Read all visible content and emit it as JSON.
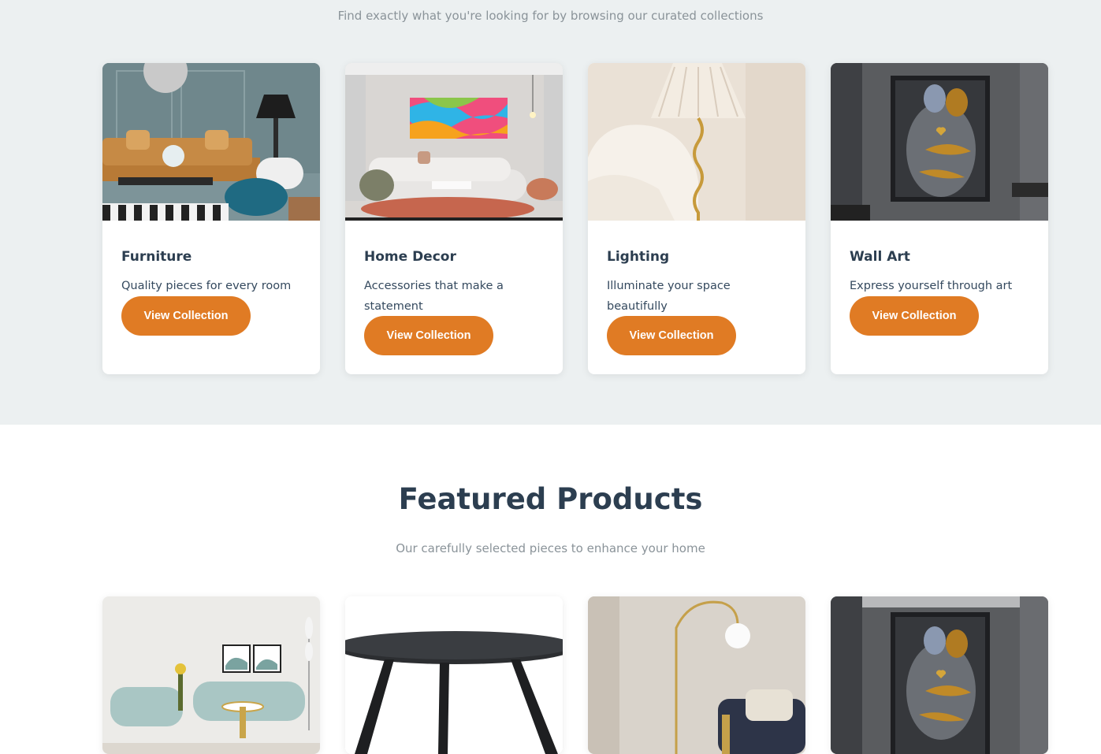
{
  "collections": {
    "subtitle": "Find exactly what you're looking for by browsing our curated collections",
    "items": [
      {
        "title": "Furniture",
        "description": "Quality pieces for every room",
        "button": "View Collection"
      },
      {
        "title": "Home Decor",
        "description": "Accessories that make a statement",
        "button": "View Collection"
      },
      {
        "title": "Lighting",
        "description": "Illuminate your space beautifully",
        "button": "View Collection"
      },
      {
        "title": "Wall Art",
        "description": "Express yourself through art",
        "button": "View Collection"
      }
    ]
  },
  "featured": {
    "title": "Featured Products",
    "subtitle": "Our carefully selected pieces to enhance your home"
  },
  "colors": {
    "accent": "#e07b24",
    "heading": "#2c3e50",
    "section_bg": "#ecf0f1"
  }
}
